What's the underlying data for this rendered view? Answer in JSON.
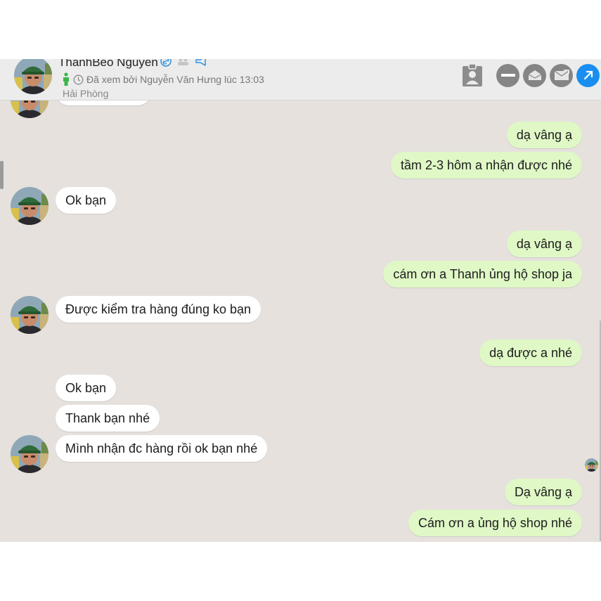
{
  "header": {
    "contact_name": "ThanhBeo Nguyen",
    "seen_status": "Đã xem bởi Nguyễn Văn Hưng lúc 13:03",
    "location": "Hải Phòng"
  },
  "colors": {
    "chat_background": "#e6e1dd",
    "incoming_bubble": "#ffffff",
    "outgoing_bubble": "#dff8c6",
    "accent_blue": "#1a8ef0",
    "online_green": "#3bb54a"
  },
  "icons": {
    "header_actions": [
      "contact-card-icon",
      "minimize-icon",
      "inbox-icon",
      "email-icon",
      "open-external-icon"
    ],
    "name_badges": [
      "link-icon",
      "group-icon",
      "megaphone-icon"
    ]
  },
  "messages": [
    {
      "side": "outgoing",
      "text": "dạ vâng ạ"
    },
    {
      "side": "outgoing",
      "text": "tầm 2-3 hôm a nhận được nhé"
    },
    {
      "side": "incoming",
      "text": "Ok bạn"
    },
    {
      "side": "outgoing",
      "text": "dạ vâng ạ"
    },
    {
      "side": "outgoing",
      "text": "cám ơn a Thanh ủng hộ shop ja"
    },
    {
      "side": "incoming",
      "text": "Được kiểm tra hàng đúng ko bạn"
    },
    {
      "side": "outgoing",
      "text": "dạ được a nhé"
    },
    {
      "side": "incoming",
      "text": "Ok bạn"
    },
    {
      "side": "incoming",
      "text": "Thank bạn nhé"
    },
    {
      "side": "incoming",
      "text": "Mình nhận đc hàng rồi ok bạn nhé"
    },
    {
      "side": "outgoing",
      "text": "Dạ vâng ạ"
    },
    {
      "side": "outgoing",
      "text": "Cám ơn a ủng hộ shop nhé"
    }
  ]
}
